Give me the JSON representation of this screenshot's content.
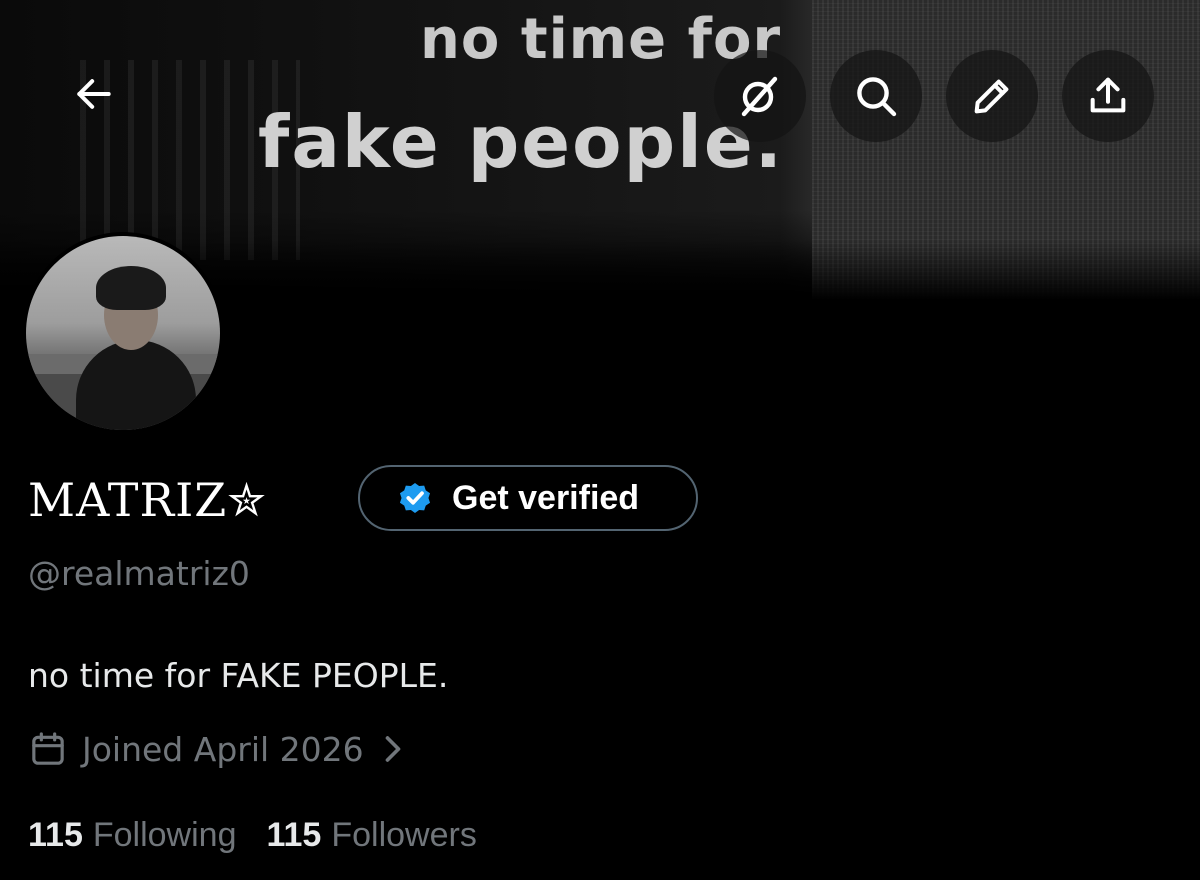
{
  "banner": {
    "line1": "no time for",
    "line2": "fake people."
  },
  "header": {
    "icons": [
      "back-arrow-icon",
      "grok-icon",
      "search-icon",
      "edit-pencil-icon",
      "share-icon"
    ]
  },
  "profile": {
    "display_name": "MATRIZ✮",
    "handle": "@realmatriz0",
    "bio": "no time for FAKE PEOPLE.",
    "joined": "Joined April 2026",
    "get_verified_label": "Get verified",
    "following_count": "115",
    "following_label": "Following",
    "followers_count": "115",
    "followers_label": "Followers"
  },
  "colors": {
    "background": "#000000",
    "verified_blue": "#1d9bf0",
    "secondary_text": "#71767b",
    "primary_text": "#e7e9ea",
    "button_border": "#536471"
  }
}
